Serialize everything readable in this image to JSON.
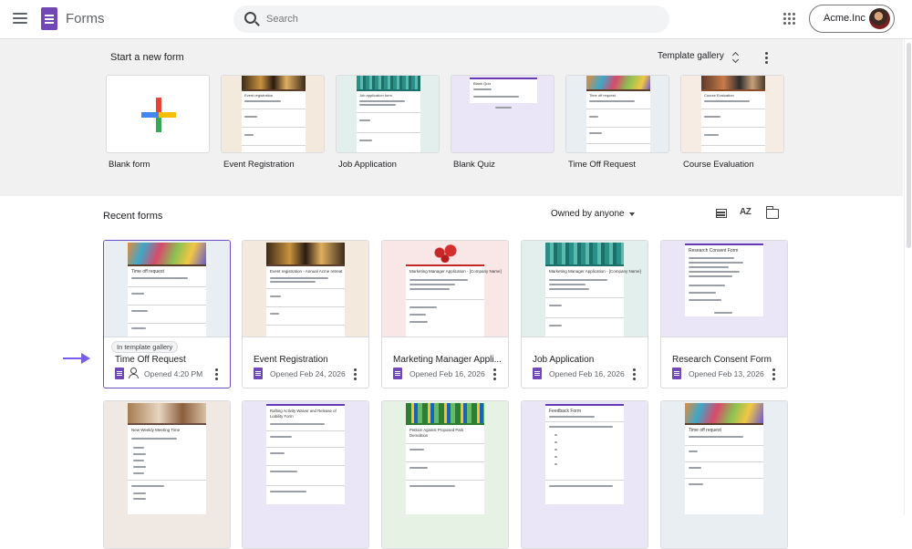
{
  "app": {
    "title": "Forms"
  },
  "search": {
    "placeholder": "Search"
  },
  "account": {
    "name": "Acme.Inc"
  },
  "templates": {
    "title": "Start a new form",
    "gallery_label": "Template gallery",
    "items": [
      {
        "label": "Blank form"
      },
      {
        "label": "Event Registration",
        "thumb_title": "Event registration"
      },
      {
        "label": "Job Application",
        "thumb_title": "Job application form"
      },
      {
        "label": "Blank Quiz",
        "thumb_title": "Blank Quiz"
      },
      {
        "label": "Time Off Request",
        "thumb_title": "Time off request"
      },
      {
        "label": "Course Evaluation",
        "thumb_title": "Course Evaluation"
      }
    ]
  },
  "recent": {
    "title": "Recent forms",
    "owner_filter": "Owned by anyone",
    "sort_label": "AZ",
    "row1": [
      {
        "name": "Time Off Request",
        "meta": "Opened 4:20 PM",
        "badge": "In template gallery",
        "thumb_title": "Time off request"
      },
      {
        "name": "Event Registration",
        "meta": "Opened Feb 24, 2026",
        "thumb_title": "Event registration - Annual Acme retreat"
      },
      {
        "name": "Marketing Manager Appli...",
        "meta": "Opened Feb 16, 2026",
        "thumb_title": "Marketing Manager Application - [Company Name]"
      },
      {
        "name": "Job Application",
        "meta": "Opened Feb 16, 2026",
        "thumb_title": "Marketing Manager Application - [Company Name]"
      },
      {
        "name": "Research Consent Form",
        "meta": "Opened Feb 13, 2026",
        "thumb_title": "Research Consent Form"
      }
    ],
    "row2": [
      {
        "thumb_title": "New Weekly Meeting Time"
      },
      {
        "thumb_title": "Rafting Activity Waiver and Release of Liability Form"
      },
      {
        "thumb_title": "Petition Against Proposed Park Demolition"
      },
      {
        "thumb_title": "Feedback Form"
      },
      {
        "thumb_title": "Time off request"
      }
    ]
  },
  "colors": {
    "brand": "#7248b9",
    "selected_border": "#6a4fc9",
    "arrow": "#7b5cf0"
  }
}
